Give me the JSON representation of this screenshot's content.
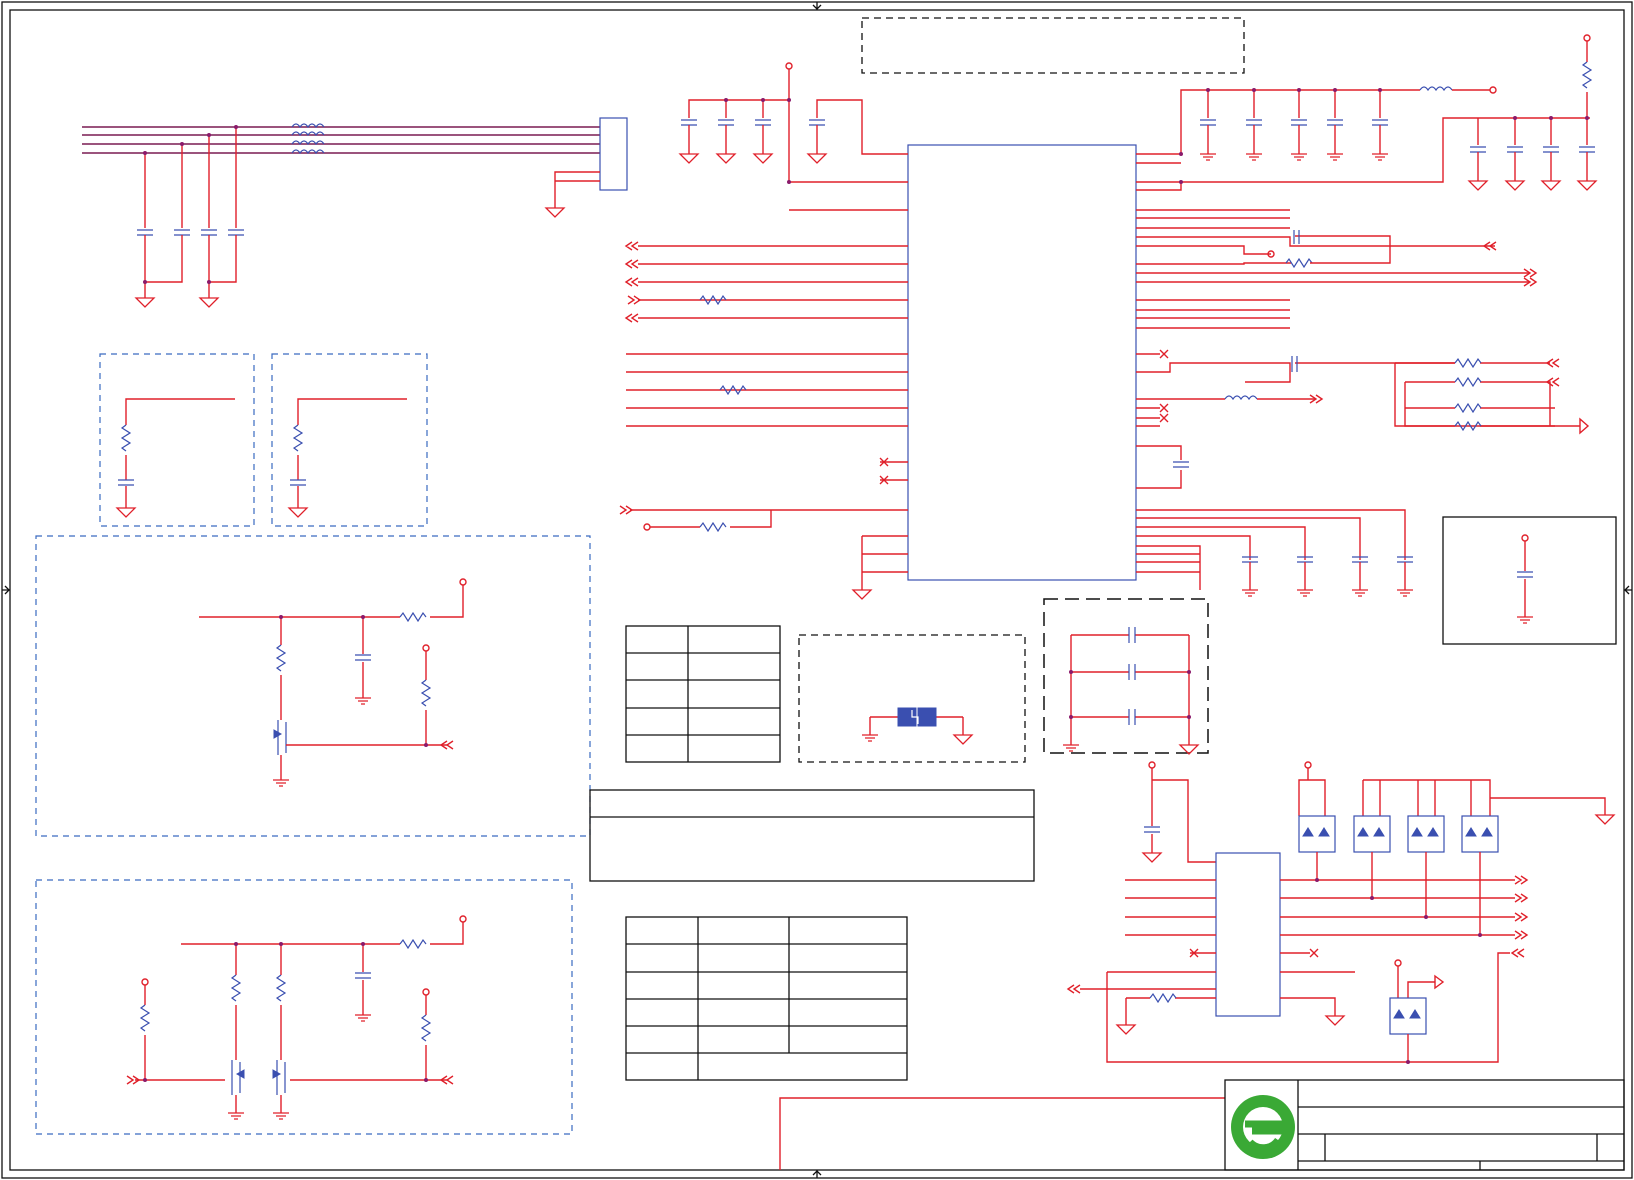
{
  "sheet": {
    "border_color": "#111111",
    "wire_color": "#e0202a",
    "bus_color": "#7a1c52",
    "component_color": "#3a4fb0",
    "annotation_box_color": "#3a6ac0"
  },
  "title_block": {
    "logo": "green-e-logo",
    "logo_color": "#3aa935"
  },
  "icons": {
    "inductor": "inductor-symbol",
    "resistor": "resistor-symbol",
    "capacitor": "capacitor-symbol",
    "ground": "ground-symbol",
    "mosfet": "n-channel-mosfet-symbol",
    "diode_array": "esd-diode-array-symbol",
    "main_ic": "main-ic-block",
    "connector": "connector-block",
    "crystal": "crystal-symbol"
  }
}
